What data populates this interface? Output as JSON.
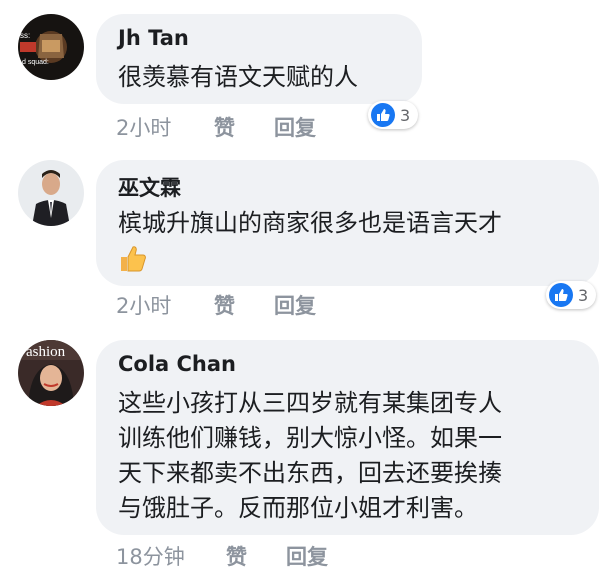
{
  "comments": [
    {
      "author": "Jh Tan",
      "avatar_text_1": "ss:",
      "avatar_text_2": "d squad:",
      "lines": [
        "很羡慕有语文天赋的人"
      ],
      "time": "2小时",
      "like_label": "赞",
      "reply_label": "回复",
      "reactions": "3"
    },
    {
      "author": "巫文霖",
      "lines": [
        "槟城升旗山的商家很多也是语言天才"
      ],
      "emoji": "thumbs-up",
      "time": "2小时",
      "like_label": "赞",
      "reply_label": "回复",
      "reactions": "3"
    },
    {
      "author": "Cola Chan",
      "avatar_text": "ashion",
      "lines": [
        "这些小孩打从三四岁就有某集团专人",
        "训练他们赚钱，别大惊小怪。如果一",
        "天下来都卖不出东西，回去还要挨揍",
        "与饿肚子。反而那位小姐才利害。"
      ],
      "time": "18分钟",
      "like_label": "赞",
      "reply_label": "回复"
    }
  ],
  "colors": {
    "bubble": "#f0f2f5",
    "meta": "#8d949e",
    "like_blue": "#1877f2"
  }
}
